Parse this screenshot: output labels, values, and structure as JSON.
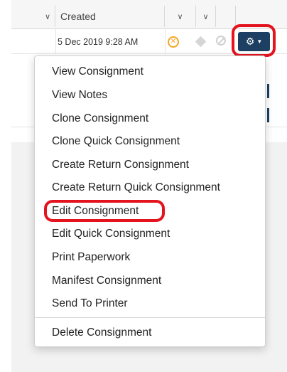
{
  "grid": {
    "columns": [
      {
        "label": ""
      },
      {
        "label": "Created"
      },
      {
        "label": ""
      },
      {
        "label": ""
      }
    ],
    "rows": [
      {
        "created": "5 Dec 2019 9:28 AM"
      }
    ]
  },
  "row_actions": {
    "status_icon": "x-circle-icon",
    "diamond_icon": "diamond-icon",
    "disabled_icon": "no-entry-icon",
    "gear_button_icon": "gear-icon"
  },
  "menu": {
    "items": [
      "View Consignment",
      "View Notes",
      "Clone Consignment",
      "Clone Quick Consignment",
      "Create Return Consignment",
      "Create Return Quick Consignment",
      "Edit Consignment",
      "Edit Quick Consignment",
      "Print Paperwork",
      "Manifest Consignment",
      "Send To Printer"
    ],
    "danger_items": [
      "Delete Consignment"
    ]
  },
  "colors": {
    "highlight": "#e3141e",
    "button_bg": "#1c3f62",
    "status_orange": "#f5a623"
  }
}
